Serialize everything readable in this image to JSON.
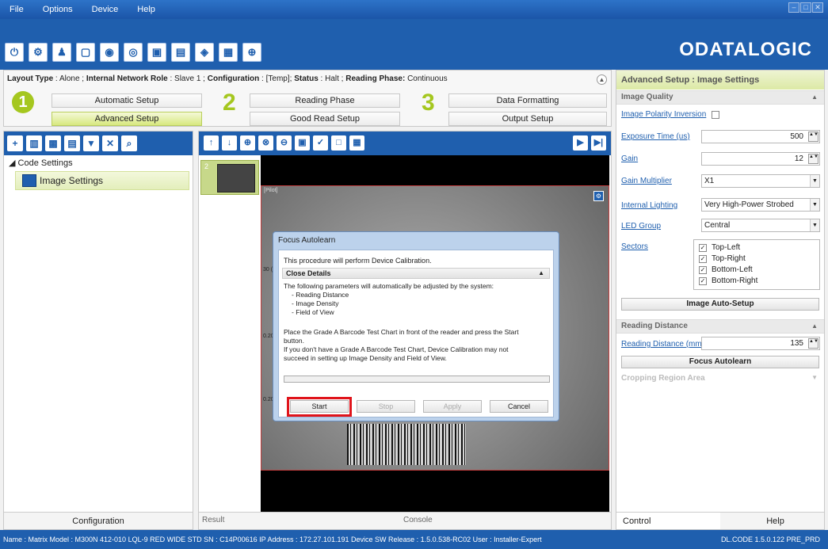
{
  "menu": [
    "File",
    "Options",
    "Device",
    "Help"
  ],
  "window_controls": [
    "–",
    "□",
    "✕"
  ],
  "toolbar_icons": [
    "power-icon",
    "gear-icon",
    "user-icon",
    "panel-icon",
    "camera-icon",
    "camera-settings-icon",
    "monitor-icon",
    "document-icon",
    "camera-list-icon",
    "camera-code-icon",
    "crosshair-icon"
  ],
  "logo": "ODATALOGIC",
  "setup": {
    "layout_type_label": "Layout Type",
    "layout_type": "Alone",
    "network_role_label": "Internal Network Role",
    "network_role": "Slave 1",
    "configuration_label": "Configuration",
    "configuration": "[Temp]",
    "status_label": "Status",
    "status": "Halt",
    "reading_phase_label": "Reading Phase:",
    "reading_phase": "Continuous",
    "step1": "1",
    "step2": "2",
    "step3": "3",
    "automatic_setup": "Automatic Setup",
    "advanced_setup": "Advanced Setup",
    "reading_phase_btn": "Reading Phase",
    "good_read_setup": "Good Read Setup",
    "data_formatting": "Data Formatting",
    "output_setup": "Output Setup"
  },
  "tree": {
    "root": "Code Settings",
    "child": "Image Settings"
  },
  "left_footer": "Configuration",
  "image_panel": {
    "thumb_number": "2",
    "cam_label": "[Pilot]",
    "axis_labels": [
      "30 (",
      "0.20",
      "0.20"
    ],
    "footer_tab": "Result",
    "footer_console": "Console"
  },
  "dialog": {
    "title": "Focus Autolearn",
    "intro": "This procedure will perform Device Calibration.",
    "details": "Close Details",
    "line1": "The following parameters will automatically be adjusted by the system:",
    "line2": "- Reading Distance",
    "line3": "- Image Density",
    "line4": "- Field of View",
    "line5": "Place the Grade A Barcode Test Chart in front of the reader and press the Start",
    "line6": "button.",
    "line7": "If you don't have a Grade A Barcode Test Chart, Device Calibration may not",
    "line8": "succeed in setting up Image Density and Field of View.",
    "start": "Start",
    "stop": "Stop",
    "apply": "Apply",
    "cancel": "Cancel"
  },
  "right_panel": {
    "title": "Advanced Setup : Image Settings",
    "image_quality": "Image Quality",
    "polarity_label": "Image Polarity Inversion",
    "exposure_label": "Exposure Time (us)",
    "exposure_value": "500",
    "gain_label": "Gain",
    "gain_value": "12",
    "gain_mult_label": "Gain Multiplier",
    "gain_mult_value": "X1",
    "lighting_label": "Internal Lighting",
    "lighting_value": "Very High-Power Strobed",
    "led_label": "LED Group",
    "led_value": "Central",
    "sectors_label": "Sectors",
    "sectors": [
      "Top-Left",
      "Top-Right",
      "Bottom-Left",
      "Bottom-Right"
    ],
    "auto_setup_btn": "Image Auto-Setup",
    "reading_distance_section": "Reading Distance",
    "reading_distance_label": "Reading Distance (mm)",
    "reading_distance_value": "135",
    "focus_btn": "Focus Autolearn",
    "cropping": "Cropping Region Area",
    "footer_control": "Control",
    "footer_help": "Help"
  },
  "status_bar": {
    "left": "Name : Matrix  Model : M300N 412-010 LQL-9 RED WIDE STD  SN : C14P00616  IP Address : 172.27.101.191  Device SW Release : 1.5.0.538-RC02  User : Installer-Expert",
    "right": "DL.CODE 1.5.0.122 PRE_PRD"
  }
}
